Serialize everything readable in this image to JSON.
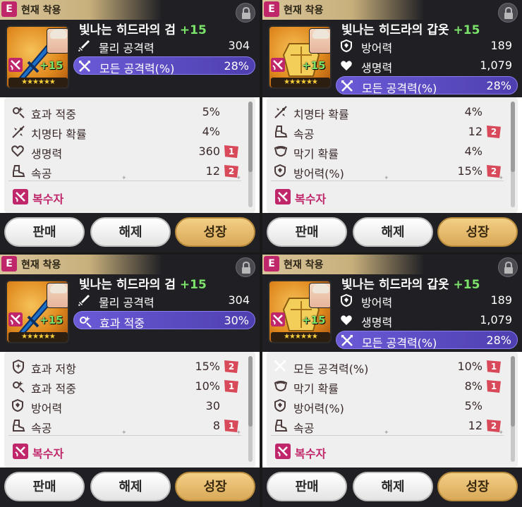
{
  "panels": [
    {
      "header": {
        "equip_badge": "E",
        "status": "현재 착용"
      },
      "item": {
        "name": "빛나는 히드라의 검",
        "plus": "+15",
        "level": "+15",
        "stars": "★★★★★★",
        "icon": "sword-icon"
      },
      "main_stats": [
        {
          "name": "물리 공격력",
          "value": "304",
          "highlight": false,
          "icon": "sword-icon"
        },
        {
          "name": "모든 공격력(%)",
          "value": "28%",
          "highlight": true,
          "icon": "crossed-swords-icon"
        }
      ],
      "sub_stats": [
        {
          "name": "효과 적중",
          "value": "5%",
          "badge": "",
          "icon": "effect-hit-icon"
        },
        {
          "name": "치명타 확률",
          "value": "4%",
          "badge": "",
          "icon": "critical-icon"
        },
        {
          "name": "생명력",
          "value": "360",
          "badge": "1",
          "icon": "heart-icon"
        },
        {
          "name": "속공",
          "value": "12",
          "badge": "2",
          "icon": "boot-icon"
        }
      ],
      "set": {
        "name": "복수자",
        "icon": "avenger-set-icon"
      },
      "buttons": {
        "sell": "판매",
        "unequip": "해제",
        "enhance": "성장"
      }
    },
    {
      "header": {
        "equip_badge": "E",
        "status": "현재 착용"
      },
      "item": {
        "name": "빛나는 히드라의 갑옷",
        "plus": "+15",
        "level": "+15",
        "stars": "★★★★★★",
        "icon": "armor-icon"
      },
      "main_stats": [
        {
          "name": "방어력",
          "value": "189",
          "highlight": false,
          "icon": "shield-icon"
        },
        {
          "name": "생명력",
          "value": "1,079",
          "highlight": false,
          "icon": "heart-icon"
        },
        {
          "name": "모든 공격력(%)",
          "value": "28%",
          "highlight": true,
          "icon": "crossed-swords-icon"
        }
      ],
      "sub_stats": [
        {
          "name": "치명타 확률",
          "value": "4%",
          "badge": "",
          "icon": "critical-icon"
        },
        {
          "name": "속공",
          "value": "12",
          "badge": "2",
          "icon": "boot-icon"
        },
        {
          "name": "막기 확률",
          "value": "4%",
          "badge": "",
          "icon": "block-icon"
        },
        {
          "name": "방어력(%)",
          "value": "15%",
          "badge": "2",
          "icon": "shield-icon"
        }
      ],
      "set": {
        "name": "복수자",
        "icon": "avenger-set-icon"
      },
      "buttons": {
        "sell": "판매",
        "unequip": "해제",
        "enhance": "성장"
      }
    },
    {
      "header": {
        "equip_badge": "E",
        "status": "현재 착용"
      },
      "item": {
        "name": "빛나는 히드라의 검",
        "plus": "+15",
        "level": "+15",
        "stars": "★★★★★★",
        "icon": "sword-icon"
      },
      "main_stats": [
        {
          "name": "물리 공격력",
          "value": "304",
          "highlight": false,
          "icon": "sword-icon"
        },
        {
          "name": "효과 적중",
          "value": "30%",
          "highlight": true,
          "icon": "effect-hit-icon"
        }
      ],
      "sub_stats": [
        {
          "name": "효과 저항",
          "value": "15%",
          "badge": "2",
          "icon": "effect-resist-icon"
        },
        {
          "name": "효과 적중",
          "value": "10%",
          "badge": "1",
          "icon": "effect-hit-icon"
        },
        {
          "name": "방어력",
          "value": "30",
          "badge": "",
          "icon": "shield-icon"
        },
        {
          "name": "속공",
          "value": "8",
          "badge": "1",
          "icon": "boot-icon"
        }
      ],
      "set": {
        "name": "복수자",
        "icon": "avenger-set-icon"
      },
      "buttons": {
        "sell": "판매",
        "unequip": "해제",
        "enhance": "성장"
      }
    },
    {
      "header": {
        "equip_badge": "E",
        "status": "현재 착용"
      },
      "item": {
        "name": "빛나는 히드라의 갑옷",
        "plus": "+15",
        "level": "+15",
        "stars": "★★★★★★",
        "icon": "armor-icon"
      },
      "main_stats": [
        {
          "name": "방어력",
          "value": "189",
          "highlight": false,
          "icon": "shield-icon"
        },
        {
          "name": "생명력",
          "value": "1,079",
          "highlight": false,
          "icon": "heart-icon"
        },
        {
          "name": "모든 공격력(%)",
          "value": "28%",
          "highlight": true,
          "icon": "crossed-swords-icon"
        }
      ],
      "sub_stats": [
        {
          "name": "모든 공격력(%)",
          "value": "10%",
          "badge": "1",
          "icon": "crossed-swords-icon"
        },
        {
          "name": "막기 확률",
          "value": "8%",
          "badge": "1",
          "icon": "block-icon"
        },
        {
          "name": "방어력(%)",
          "value": "5%",
          "badge": "",
          "icon": "shield-icon"
        },
        {
          "name": "속공",
          "value": "12",
          "badge": "2",
          "icon": "boot-icon"
        }
      ],
      "set": {
        "name": "복수자",
        "icon": "avenger-set-icon"
      },
      "buttons": {
        "sell": "판매",
        "unequip": "해제",
        "enhance": "성장"
      }
    }
  ]
}
